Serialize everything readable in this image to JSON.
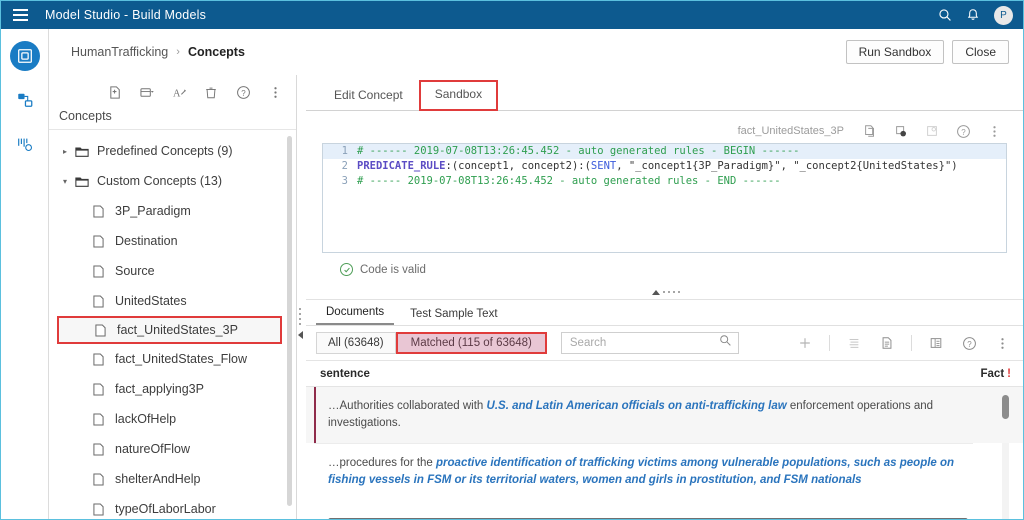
{
  "topbar": {
    "title": "Model Studio - Build Models",
    "menu_icon": "hamburger-icon",
    "search_icon": "search-icon",
    "notifications_icon": "bell-icon",
    "avatar_initial": "P"
  },
  "rail": {
    "items": [
      {
        "name": "build-models-icon",
        "label": "Build Models",
        "active": true
      },
      {
        "name": "pipelines-icon",
        "label": "Pipelines",
        "active": false
      },
      {
        "name": "data-icon",
        "label": "Data",
        "active": false
      }
    ]
  },
  "breadcrumb": {
    "project": "HumanTrafficking",
    "separator": "›",
    "current": "Concepts"
  },
  "header_actions": {
    "run_sandbox": "Run Sandbox",
    "close": "Close"
  },
  "concepts_panel": {
    "label": "Concepts",
    "toolbar_icons": [
      "new-concept-icon",
      "import-concept-icon",
      "rename-concept-icon",
      "delete-icon",
      "help-icon",
      "more-options-icon"
    ],
    "tree": [
      {
        "label": "Predefined Concepts (9)",
        "type": "folder",
        "expanded": false,
        "indent": 0,
        "selected": false
      },
      {
        "label": "Custom Concepts (13)",
        "type": "folder",
        "expanded": true,
        "indent": 0,
        "selected": false
      },
      {
        "label": "3P_Paradigm",
        "type": "file",
        "indent": 1,
        "selected": false
      },
      {
        "label": "Destination",
        "type": "file",
        "indent": 1,
        "selected": false
      },
      {
        "label": "Source",
        "type": "file",
        "indent": 1,
        "selected": false
      },
      {
        "label": "UnitedStates",
        "type": "file",
        "indent": 1,
        "selected": false
      },
      {
        "label": "fact_UnitedStates_3P",
        "type": "file",
        "indent": 1,
        "selected": true
      },
      {
        "label": "fact_UnitedStates_Flow",
        "type": "file",
        "indent": 1,
        "selected": false
      },
      {
        "label": "fact_applying3P",
        "type": "file",
        "indent": 1,
        "selected": false
      },
      {
        "label": "lackOfHelp",
        "type": "file",
        "indent": 1,
        "selected": false
      },
      {
        "label": "natureOfFlow",
        "type": "file",
        "indent": 1,
        "selected": false
      },
      {
        "label": "shelterAndHelp",
        "type": "file",
        "indent": 1,
        "selected": false
      },
      {
        "label": "typeOfLaborLabor",
        "type": "file",
        "indent": 1,
        "selected": false
      }
    ]
  },
  "main_tabs": [
    {
      "label": "Edit Concept",
      "active": false,
      "highlighted": false
    },
    {
      "label": "Sandbox",
      "active": true,
      "highlighted": true
    }
  ],
  "editor": {
    "concept_name": "fact_UnitedStates_3P",
    "toolbar_icons": [
      "copy-icon",
      "paste-icon",
      "clear-icon",
      "help-icon",
      "more-options-icon"
    ],
    "lines": [
      {
        "number": "1",
        "current": true,
        "segments": [
          {
            "text": "# ------ 2019-07-08T13:26:45.452 - auto generated rules - BEGIN ------",
            "style": "comment"
          }
        ]
      },
      {
        "number": "2",
        "current": false,
        "segments": [
          {
            "text": "PREDICATE_RULE",
            "style": "kw"
          },
          {
            "text": ":(concept1, concept2):(",
            "style": "plain"
          },
          {
            "text": "SENT",
            "style": "fn"
          },
          {
            "text": ", \"_concept1{3P_Paradigm}\", \"_concept2{UnitedStates}\")",
            "style": "plain"
          }
        ]
      },
      {
        "number": "3",
        "current": false,
        "segments": [
          {
            "text": "# ----- 2019-07-08T13:26:45.452 - auto generated rules - END ------",
            "style": "comment"
          }
        ]
      }
    ],
    "status_icon": "check-circle-icon",
    "status_text": "Code is valid",
    "status_color": "#4f9e58"
  },
  "documents": {
    "tabs": [
      {
        "label": "Documents",
        "active": true
      },
      {
        "label": "Test Sample Text",
        "active": false
      }
    ],
    "filters": [
      {
        "label": "All (63648)",
        "active": false,
        "highlighted": false
      },
      {
        "label": "Matched (115 of 63648)",
        "active": true,
        "highlighted": true
      }
    ],
    "search": {
      "value": "",
      "placeholder": "Search",
      "icon": "search-icon"
    },
    "toolbar_icons": [
      "add-icon",
      "list-view-icon",
      "document-view-icon",
      "table-view-icon",
      "help-icon",
      "more-options-icon"
    ],
    "columns": [
      {
        "label": "sentence"
      },
      {
        "label": "Fact",
        "badge": "!"
      }
    ],
    "rows": [
      {
        "selected": true,
        "parts": [
          {
            "text": "…Authorities collaborated with ",
            "highlight": false
          },
          {
            "text": "U.S. and Latin American officials on anti-trafficking law",
            "highlight": true
          },
          {
            "text": " enforcement operations and investigations.",
            "highlight": false
          }
        ]
      },
      {
        "selected": false,
        "parts": [
          {
            "text": "…procedures for the ",
            "highlight": false
          },
          {
            "text": "proactive identification of trafficking victims among vulnerable populations, such as people on fishing vessels in FSM or its territorial waters, women and girls in prostitution, and FSM nationals",
            "highlight": true
          }
        ]
      }
    ]
  },
  "colors": {
    "topbar": "#0d5a8f",
    "accent_blue": "#1a7cc4",
    "highlight_red": "#e03b3b",
    "matched_pink": "#e9c6d4",
    "link_blue": "#2a74bd",
    "comment_green": "#2e9e4f",
    "keyword_purple": "#5b4cc4"
  }
}
